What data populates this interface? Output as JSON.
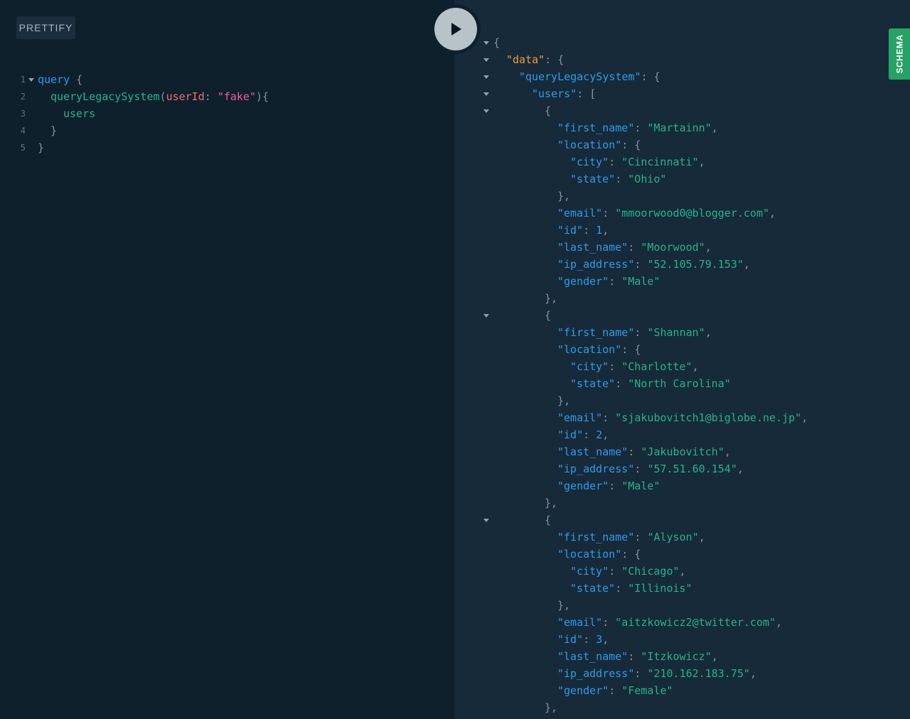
{
  "toolbar": {
    "prettify_label": "PRETTIFY"
  },
  "sidebar_tab": {
    "schema_label": "SCHEMA"
  },
  "query": {
    "line_numbers": [
      "1",
      "2",
      "3",
      "4",
      "5"
    ],
    "keyword_query": "query",
    "field_name": "queryLegacySystem",
    "arg_name": "userId",
    "arg_value": "\"fake\"",
    "subfield": "users"
  },
  "result": {
    "data_key": "\"data\"",
    "system_key": "\"queryLegacySystem\"",
    "users_key": "\"users\"",
    "field_keys": {
      "first_name": "\"first_name\"",
      "location": "\"location\"",
      "city": "\"city\"",
      "state": "\"state\"",
      "email": "\"email\"",
      "id": "\"id\"",
      "last_name": "\"last_name\"",
      "ip_address": "\"ip_address\"",
      "gender": "\"gender\""
    },
    "users": [
      {
        "first_name": "\"Martainn\"",
        "city": "\"Cincinnati\"",
        "state": "\"Ohio\"",
        "email": "\"mmoorwood0@blogger.com\"",
        "id": "1",
        "last_name": "\"Moorwood\"",
        "ip_address": "\"52.105.79.153\"",
        "gender": "\"Male\""
      },
      {
        "first_name": "\"Shannan\"",
        "city": "\"Charlotte\"",
        "state": "\"North Carolina\"",
        "email": "\"sjakubovitch1@biglobe.ne.jp\"",
        "id": "2",
        "last_name": "\"Jakubovitch\"",
        "ip_address": "\"57.51.60.154\"",
        "gender": "\"Male\""
      },
      {
        "first_name": "\"Alyson\"",
        "city": "\"Chicago\"",
        "state": "\"Illinois\"",
        "email": "\"aitzkowicz2@twitter.com\"",
        "id": "3",
        "last_name": "\"Itzkowicz\"",
        "ip_address": "\"210.162.183.75\"",
        "gender": "\"Female\""
      }
    ]
  }
}
